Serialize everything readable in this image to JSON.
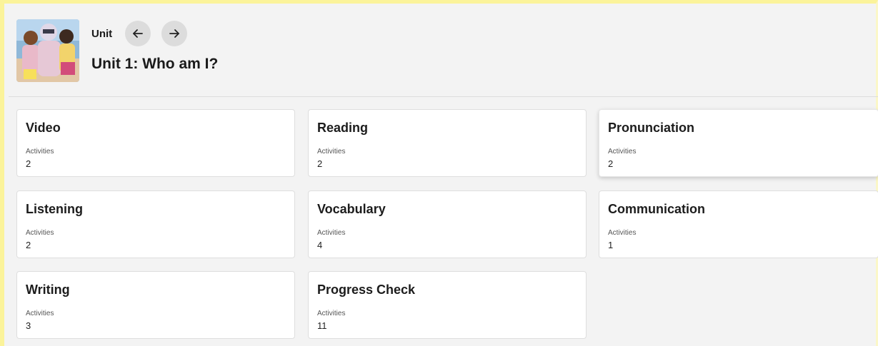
{
  "header": {
    "unit_label": "Unit",
    "title": "Unit 1: Who am I?",
    "prev_icon": "arrow-left-icon",
    "next_icon": "arrow-right-icon"
  },
  "cards": [
    {
      "title": "Video",
      "sub": "Activities",
      "count": "2"
    },
    {
      "title": "Reading",
      "sub": "Activities",
      "count": "2"
    },
    {
      "title": "Pronunciation",
      "sub": "Activities",
      "count": "2"
    },
    {
      "title": "Listening",
      "sub": "Activities",
      "count": "2"
    },
    {
      "title": "Vocabulary",
      "sub": "Activities",
      "count": "4"
    },
    {
      "title": "Communication",
      "sub": "Activities",
      "count": "1"
    },
    {
      "title": "Writing",
      "sub": "Activities",
      "count": "3"
    },
    {
      "title": "Progress Check",
      "sub": "Activities",
      "count": "11"
    }
  ],
  "colors": {
    "frame_highlight": "#fbf39a",
    "background": "#f3f3f3",
    "nav_button": "#dcdcdc",
    "card": "#ffffff"
  }
}
